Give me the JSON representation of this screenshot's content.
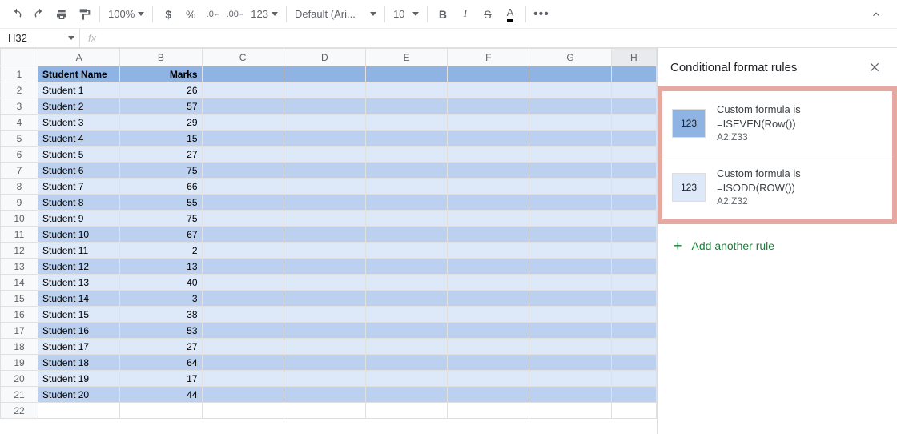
{
  "toolbar": {
    "zoom": "100%",
    "font": "Default (Ari...",
    "size": "10"
  },
  "namebox": {
    "ref": "H32"
  },
  "columns": [
    "A",
    "B",
    "C",
    "D",
    "E",
    "F",
    "G",
    "H"
  ],
  "sheet": {
    "headers": [
      "Student Name",
      "Marks"
    ],
    "rows": [
      {
        "n": "Student 1",
        "m": "26"
      },
      {
        "n": "Student 2",
        "m": "57"
      },
      {
        "n": "Student 3",
        "m": "29"
      },
      {
        "n": "Student 4",
        "m": "15"
      },
      {
        "n": "Student 5",
        "m": "27"
      },
      {
        "n": "Student 6",
        "m": "75"
      },
      {
        "n": "Student 7",
        "m": "66"
      },
      {
        "n": "Student 8",
        "m": "55"
      },
      {
        "n": "Student 9",
        "m": "75"
      },
      {
        "n": "Student 10",
        "m": "67"
      },
      {
        "n": "Student 11",
        "m": "2"
      },
      {
        "n": "Student 12",
        "m": "13"
      },
      {
        "n": "Student 13",
        "m": "40"
      },
      {
        "n": "Student 14",
        "m": "3"
      },
      {
        "n": "Student 15",
        "m": "38"
      },
      {
        "n": "Student 16",
        "m": "53"
      },
      {
        "n": "Student 17",
        "m": "27"
      },
      {
        "n": "Student 18",
        "m": "64"
      },
      {
        "n": "Student 19",
        "m": "17"
      },
      {
        "n": "Student 20",
        "m": "44"
      }
    ]
  },
  "sidepanel": {
    "title": "Conditional format rules",
    "swatch_label": "123",
    "rules": [
      {
        "label": "Custom formula is",
        "formula": "=ISEVEN(Row())",
        "range": "A2:Z33"
      },
      {
        "label": "Custom formula is",
        "formula": "=ISODD(ROW())",
        "range": "A2:Z32"
      }
    ],
    "add": "Add another rule"
  }
}
